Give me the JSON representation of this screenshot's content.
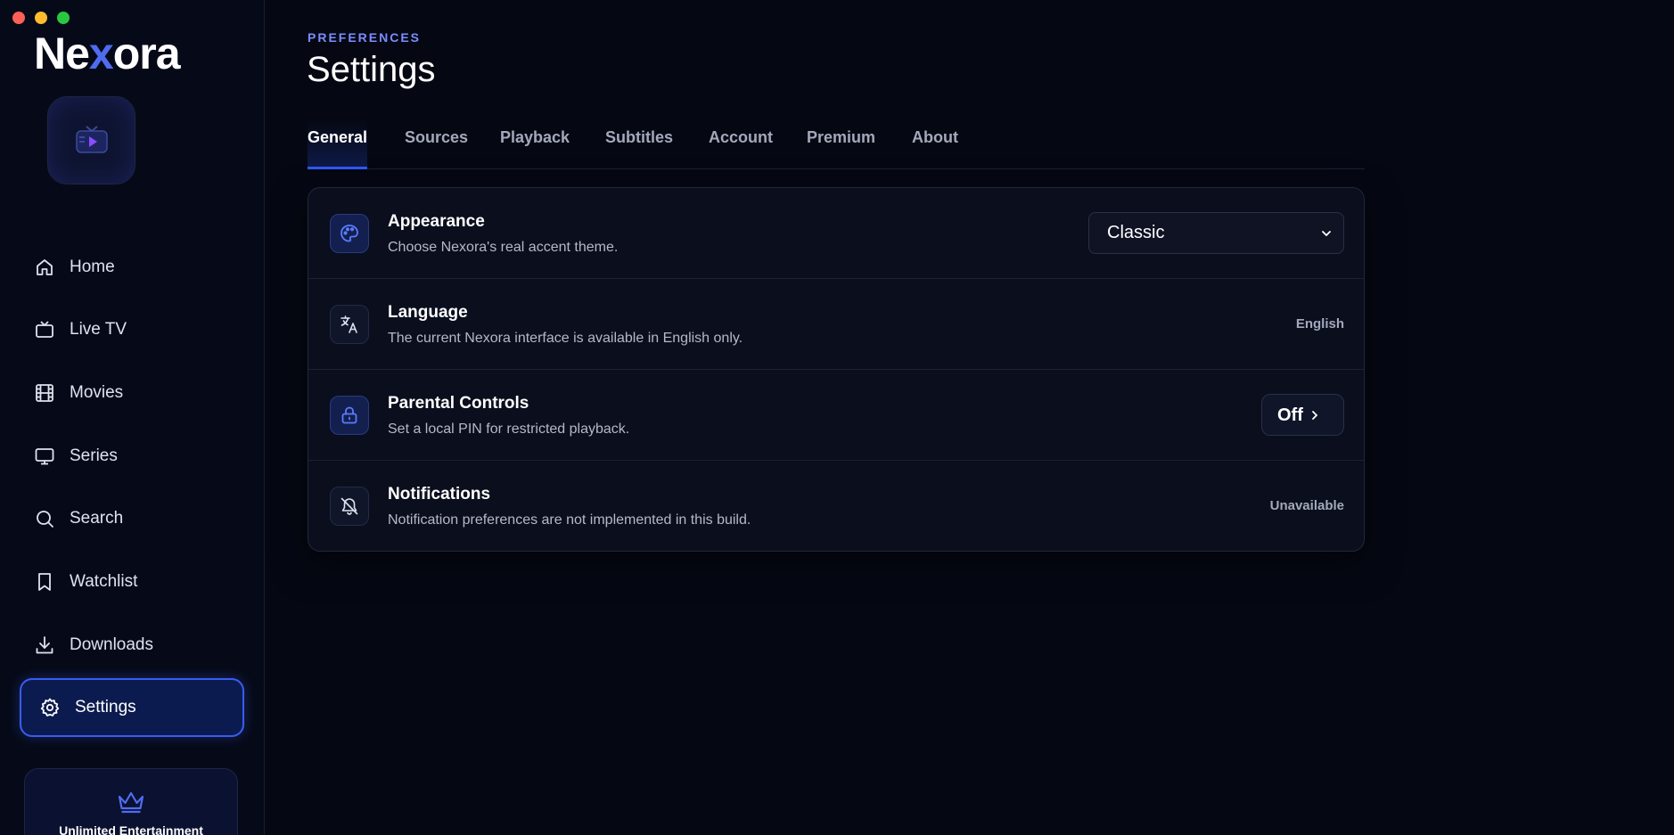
{
  "app": {
    "logo_pre": "Ne",
    "logo_x": "x",
    "logo_post": "ora"
  },
  "sidebar": {
    "items": [
      {
        "label": "Home",
        "icon": "home-icon"
      },
      {
        "label": "Live TV",
        "icon": "tv-icon"
      },
      {
        "label": "Movies",
        "icon": "film-icon"
      },
      {
        "label": "Series",
        "icon": "monitor-icon"
      },
      {
        "label": "Search",
        "icon": "search-icon"
      },
      {
        "label": "Watchlist",
        "icon": "bookmark-icon"
      },
      {
        "label": "Downloads",
        "icon": "download-icon"
      },
      {
        "label": "Settings",
        "icon": "gear-icon",
        "active": true
      }
    ],
    "promo_title": "Unlimited Entertainment"
  },
  "header": {
    "eyebrow": "PREFERENCES",
    "title": "Settings"
  },
  "tabs": [
    {
      "label": "General",
      "active": true
    },
    {
      "label": "Sources"
    },
    {
      "label": "Playback"
    },
    {
      "label": "Subtitles"
    },
    {
      "label": "Account"
    },
    {
      "label": "Premium"
    },
    {
      "label": "About"
    }
  ],
  "settings": {
    "appearance": {
      "title": "Appearance",
      "desc": "Choose Nexora's real accent theme.",
      "value": "Classic",
      "icon": "palette-icon"
    },
    "language": {
      "title": "Language",
      "desc": "The current Nexora interface is available in English only.",
      "value": "English",
      "icon": "translate-icon"
    },
    "parental": {
      "title": "Parental Controls",
      "desc": "Set a local PIN for restricted playback.",
      "value": "Off",
      "icon": "lock-icon"
    },
    "notifications": {
      "title": "Notifications",
      "desc": "Notification preferences are not implemented in this build.",
      "value": "Unavailable",
      "icon": "bell-off-icon"
    }
  },
  "colors": {
    "accent": "#2f57ff",
    "eyebrow": "#7b8cff",
    "background": "#050813"
  }
}
